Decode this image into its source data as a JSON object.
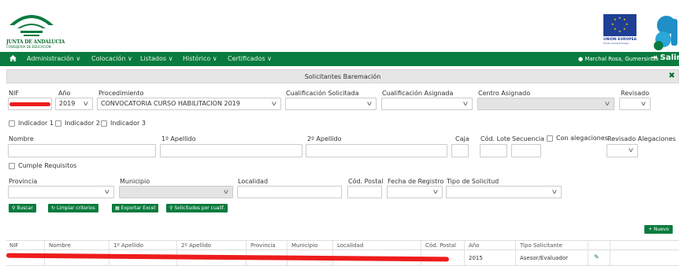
{
  "header": {
    "org_name": "JUNTA DE ANDALUCIA",
    "org_sub": "CONSEJERÍA DE EDUCACIÓN",
    "eu_name": "UNIÓN EUROPEA",
    "eu_sub": "Fondo Social Europeo"
  },
  "nav": {
    "items": [
      "Administración ∨",
      "Colocación ∨",
      "Listados ∨",
      "Histórico ∨",
      "Certificados ∨"
    ],
    "user": "Marchal Rosa, Gumersinda",
    "exit": "Salir"
  },
  "panel": {
    "title": "Solicitantes Baremación"
  },
  "form": {
    "nif_label": "NIF",
    "anio_label": "Año",
    "anio_value": "2019",
    "procedimiento_label": "Procedimiento",
    "procedimiento_value": "CONVOCATORIA CURSO HABILITACION 2019",
    "cualif_solicitada_label": "Cualificación Solicitada",
    "cualif_asignada_label": "Cualificación Asignada",
    "centro_asignado_label": "Centro Asignado",
    "revisado_label": "Revisado",
    "indicadores": [
      "Indicador 1",
      "Indicador 2",
      "Indicador 3"
    ],
    "nombre_label": "Nombre",
    "apellido1_label": "1º Apellido",
    "apellido2_label": "2º Apellido",
    "caja_label": "Caja",
    "cod_lote_label": "Cód. Lote",
    "secuencia_label": "Secuencia",
    "con_alegaciones_label": "Con alegaciones",
    "revisado_alegaciones_label": "Revisado Alegaciones",
    "cumple_requisitos_label": "Cumple Requisitos",
    "provincia_label": "Provincia",
    "municipio_label": "Municipio",
    "localidad_label": "Localidad",
    "cod_postal_label": "Cód. Postal",
    "fecha_registro_label": "Fecha de Registro",
    "tipo_solicitud_label": "Tipo de Solicitud"
  },
  "buttons": {
    "buscar": "Buscar",
    "limpiar": "Limpiar criterios",
    "exportar": "Exportar Excel",
    "solicitudes": "Solicitudes por cualif.",
    "nuevo": "Nuevo"
  },
  "table": {
    "columns": [
      "NIF",
      "Nombre",
      "1º Apellido",
      "2º Apellido",
      "Provincia",
      "Municipio",
      "Localidad",
      "Cód. Postal",
      "Año",
      "Tipo Solicitante"
    ],
    "rows": [
      {
        "anio": "2015",
        "tipo": "Asesor/Evaluador"
      }
    ]
  },
  "colors": {
    "brand_green": "#0a7b3e",
    "redaction": "#ee1c1c",
    "eu_blue": "#1f3f94"
  }
}
